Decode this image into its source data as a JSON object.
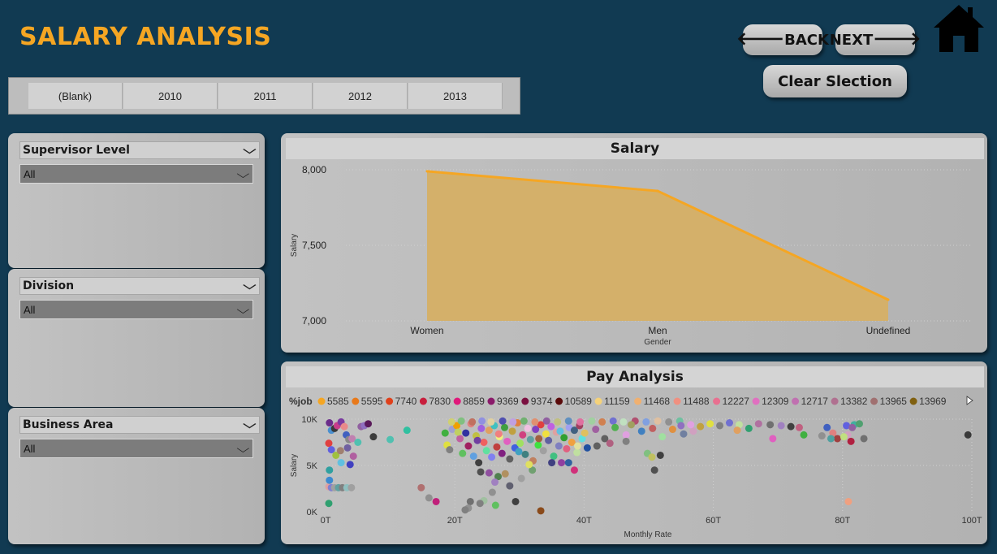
{
  "page": {
    "title": "SALARY ANALYSIS"
  },
  "nav": {
    "back_label": "BACK",
    "next_label": "NEXT",
    "clear_label": "Clear Slection",
    "back_arrow": "🡐",
    "next_arrow": "🡒"
  },
  "year_slicer": {
    "items": [
      "(Blank)",
      "2010",
      "2011",
      "2012",
      "2013"
    ]
  },
  "slicers": [
    {
      "title": "Supervisor Level",
      "value": "All"
    },
    {
      "title": "Division",
      "value": "All"
    },
    {
      "title": "Business Area",
      "value": "All"
    }
  ],
  "salary_chart": {
    "title": "Salary"
  },
  "pay_chart": {
    "title": "Pay Analysis",
    "legend_title": "%job"
  },
  "colors": {
    "background": "#113a52",
    "accent": "#f5a623",
    "area_fill": "#d4b06a",
    "area_line": "#f5a623"
  },
  "chart_data": [
    {
      "type": "area",
      "title": "Salary",
      "xlabel": "Gender",
      "ylabel": "Salary",
      "categories": [
        "Women",
        "Men",
        "Undefined"
      ],
      "values": [
        7990,
        7860,
        7140
      ],
      "ylim": [
        7000,
        8000
      ],
      "yticks": [
        {
          "v": 7000,
          "label": "7,000"
        },
        {
          "v": 7500,
          "label": "7,500"
        },
        {
          "v": 8000,
          "label": "8,000"
        }
      ],
      "grid": true
    },
    {
      "type": "scatter",
      "title": "Pay Analysis",
      "xlabel": "Monthly Rate",
      "ylabel": "Salary",
      "xlim": [
        0,
        100000
      ],
      "ylim": [
        0,
        10000
      ],
      "xticks": [
        {
          "v": 0,
          "label": "0T"
        },
        {
          "v": 20000,
          "label": "20T"
        },
        {
          "v": 40000,
          "label": "40T"
        },
        {
          "v": 60000,
          "label": "60T"
        },
        {
          "v": 80000,
          "label": "80T"
        },
        {
          "v": 100000,
          "label": "100T"
        }
      ],
      "yticks": [
        {
          "v": 0,
          "label": "0K"
        },
        {
          "v": 5000,
          "label": "5K"
        },
        {
          "v": 10000,
          "label": "10K"
        }
      ],
      "grid": true,
      "legend": [
        {
          "name": "5585",
          "color": "#f5a623"
        },
        {
          "name": "5595",
          "color": "#e8791a"
        },
        {
          "name": "7740",
          "color": "#e0401a"
        },
        {
          "name": "7830",
          "color": "#c81e3c"
        },
        {
          "name": "8859",
          "color": "#e0187a"
        },
        {
          "name": "9369",
          "color": "#8a1a6a"
        },
        {
          "name": "9374",
          "color": "#7a1040"
        },
        {
          "name": "10589",
          "color": "#5a0a0a"
        },
        {
          "name": "11159",
          "color": "#f5d27a"
        },
        {
          "name": "11468",
          "color": "#f0b070"
        },
        {
          "name": "11488",
          "color": "#f09080"
        },
        {
          "name": "12227",
          "color": "#e87090"
        },
        {
          "name": "12309",
          "color": "#e070c0"
        },
        {
          "name": "12717",
          "color": "#c070b0"
        },
        {
          "name": "13382",
          "color": "#b07090"
        },
        {
          "name": "13965",
          "color": "#a07070"
        },
        {
          "name": "13969",
          "color": "#806010"
        }
      ],
      "points": [
        [
          600,
          9600,
          "#6a2c8a"
        ],
        [
          900,
          8800,
          "#4a90d0"
        ],
        [
          1400,
          9000,
          "#3a3a3a"
        ],
        [
          1800,
          9300,
          "#c83c8a"
        ],
        [
          2400,
          9700,
          "#7a3aa0"
        ],
        [
          2900,
          9200,
          "#e88a8a"
        ],
        [
          3200,
          8300,
          "#4060c0"
        ],
        [
          3600,
          7800,
          "#888"
        ],
        [
          4100,
          7900,
          "#c080b0"
        ],
        [
          500,
          7400,
          "#e04040"
        ],
        [
          900,
          6700,
          "#6060e0"
        ],
        [
          1600,
          6100,
          "#a0c040"
        ],
        [
          2400,
          5300,
          "#60c0e0"
        ],
        [
          600,
          4500,
          "#30a0a0"
        ],
        [
          500,
          2700,
          "#e0a0a0"
        ],
        [
          900,
          2600,
          "#8080d0"
        ],
        [
          1400,
          2600,
          "#a0a0a0"
        ],
        [
          2000,
          2600,
          "#60a0a0"
        ],
        [
          2600,
          2600,
          "#808080"
        ],
        [
          3300,
          2600,
          "#90c0c0"
        ],
        [
          4000,
          2600,
          "#a0a0a0"
        ],
        [
          500,
          900,
          "#30a070"
        ],
        [
          600,
          3400,
          "#3c8ad0"
        ],
        [
          2300,
          6600,
          "#a08070"
        ],
        [
          3400,
          6900,
          "#7060a0"
        ],
        [
          3800,
          5100,
          "#4040c0"
        ],
        [
          4300,
          6000,
          "#b060a0"
        ],
        [
          5000,
          7500,
          "#50c0b0"
        ],
        [
          5500,
          9200,
          "#9060a0"
        ],
        [
          6000,
          9300,
          "#9070c0"
        ],
        [
          6600,
          9500,
          "#5a1a5a"
        ],
        [
          7400,
          8100,
          "#3c3c3c"
        ],
        [
          10000,
          7800,
          "#50c0b0"
        ],
        [
          12600,
          8800,
          "#30c0a0"
        ],
        [
          14800,
          2600,
          "#b07070"
        ],
        [
          17100,
          1100,
          "#c0207a"
        ],
        [
          16000,
          1500,
          "#909090"
        ],
        [
          18500,
          8500,
          "#40b040"
        ],
        [
          18800,
          7200,
          "#e0e040"
        ],
        [
          19200,
          6700,
          "#808080"
        ],
        [
          19600,
          8900,
          "#a0a0d0"
        ],
        [
          20300,
          9300,
          "#f0a000"
        ],
        [
          20800,
          7900,
          "#c060a0"
        ],
        [
          21200,
          6300,
          "#60c060"
        ],
        [
          21700,
          8500,
          "#3030a0"
        ],
        [
          22100,
          7100,
          "#a02060"
        ],
        [
          22500,
          9500,
          "#e08080"
        ],
        [
          22900,
          6000,
          "#60a0e0"
        ],
        [
          23300,
          8200,
          "#c0c040"
        ],
        [
          23700,
          5300,
          "#404040"
        ],
        [
          24100,
          9000,
          "#a060e0"
        ],
        [
          24500,
          7500,
          "#f06060"
        ],
        [
          24900,
          6600,
          "#60e0a0"
        ],
        [
          25300,
          8800,
          "#e0a060"
        ],
        [
          25700,
          5900,
          "#8080f0"
        ],
        [
          26100,
          9300,
          "#40c0c0"
        ],
        [
          26500,
          7000,
          "#c04040"
        ],
        [
          26900,
          8100,
          "#f0f080"
        ],
        [
          27300,
          6300,
          "#802080"
        ],
        [
          27700,
          9100,
          "#40a040"
        ],
        [
          28100,
          7600,
          "#e060c0"
        ],
        [
          28500,
          5700,
          "#606060"
        ],
        [
          28900,
          8700,
          "#c0a040"
        ],
        [
          29300,
          6900,
          "#4060e0"
        ],
        [
          29700,
          9600,
          "#e08040"
        ],
        [
          30100,
          7400,
          "#a0e060"
        ],
        [
          30500,
          8300,
          "#d04080"
        ],
        [
          30900,
          6200,
          "#408080"
        ],
        [
          31300,
          9000,
          "#f0c0e0"
        ],
        [
          31700,
          7800,
          "#60a0a0"
        ],
        [
          32100,
          5500,
          "#c08060"
        ],
        [
          32500,
          8900,
          "#8040c0"
        ],
        [
          32900,
          7200,
          "#40e040"
        ],
        [
          33300,
          9400,
          "#e04040"
        ],
        [
          33700,
          6600,
          "#a0a0a0"
        ],
        [
          34100,
          8400,
          "#f0e040"
        ],
        [
          34500,
          7700,
          "#6060a0"
        ],
        [
          34900,
          9200,
          "#c060e0"
        ],
        [
          35300,
          6000,
          "#40c080"
        ],
        [
          35700,
          8600,
          "#e0a0a0"
        ],
        [
          36100,
          7100,
          "#8080c0"
        ],
        [
          36500,
          9500,
          "#c0c0c0"
        ],
        [
          36900,
          8000,
          "#30a030"
        ],
        [
          37300,
          6800,
          "#e06080"
        ],
        [
          37700,
          9100,
          "#a0a0f0"
        ],
        [
          38100,
          7500,
          "#f0a040"
        ],
        [
          38500,
          8800,
          "#406080"
        ],
        [
          38900,
          6400,
          "#c0e0a0"
        ],
        [
          39300,
          9300,
          "#a04060"
        ],
        [
          39700,
          7900,
          "#60e0e0"
        ],
        [
          40100,
          8500,
          "#e0c060"
        ],
        [
          40500,
          6900,
          "#2050a0"
        ],
        [
          19500,
          9700,
          "#d0d070"
        ],
        [
          21000,
          9800,
          "#80c080"
        ],
        [
          22700,
          9700,
          "#c07060"
        ],
        [
          24200,
          9800,
          "#9090e0"
        ],
        [
          25600,
          9700,
          "#e0d0a0"
        ],
        [
          27400,
          9800,
          "#5050b0"
        ],
        [
          29000,
          9700,
          "#c0a0e0"
        ],
        [
          30700,
          9800,
          "#70b070"
        ],
        [
          32400,
          9700,
          "#e09070"
        ],
        [
          34200,
          9800,
          "#9060a0"
        ],
        [
          35900,
          9700,
          "#c0c080"
        ],
        [
          37600,
          9800,
          "#6090c0"
        ],
        [
          39400,
          9700,
          "#e070a0"
        ],
        [
          41200,
          9800,
          "#a0d0a0"
        ],
        [
          42800,
          9700,
          "#d08050"
        ],
        [
          44500,
          9800,
          "#7070d0"
        ],
        [
          46100,
          9700,
          "#c0e0c0"
        ],
        [
          47900,
          9800,
          "#b05070"
        ],
        [
          49600,
          9700,
          "#80a0e0"
        ],
        [
          51400,
          9800,
          "#e0c0a0"
        ],
        [
          53100,
          9700,
          "#909090"
        ],
        [
          54800,
          9800,
          "#70c0a0"
        ],
        [
          20500,
          8600,
          "#c0d060"
        ],
        [
          23500,
          7700,
          "#7040a0"
        ],
        [
          26800,
          8400,
          "#f08080"
        ],
        [
          29900,
          6500,
          "#40a0c0"
        ],
        [
          33000,
          7900,
          "#a06040"
        ],
        [
          36300,
          8700,
          "#60c0e0"
        ],
        [
          39000,
          7100,
          "#e0e0a0"
        ],
        [
          41800,
          8900,
          "#a060a0"
        ],
        [
          43200,
          7900,
          "#606060"
        ],
        [
          44800,
          9100,
          "#50b050"
        ],
        [
          46500,
          8300,
          "#e0a0e0"
        ],
        [
          47300,
          9400,
          "#a0a060"
        ],
        [
          48900,
          8700,
          "#4080c0"
        ],
        [
          50600,
          9000,
          "#c06060"
        ],
        [
          52100,
          8100,
          "#a0e0a0"
        ],
        [
          53700,
          8900,
          "#e09040"
        ],
        [
          55400,
          8400,
          "#7080a0"
        ],
        [
          56900,
          8700,
          "#d0a0c0"
        ],
        [
          24000,
          4300,
          "#505050"
        ],
        [
          25300,
          4200,
          "#9050a0"
        ],
        [
          26700,
          3800,
          "#508050"
        ],
        [
          27800,
          4100,
          "#b09060"
        ],
        [
          26200,
          3200,
          "#a080c0"
        ],
        [
          28500,
          2800,
          "#606070"
        ],
        [
          25800,
          2100,
          "#909090"
        ],
        [
          24500,
          1200,
          "#a0c0a0"
        ],
        [
          23900,
          900,
          "#808080"
        ],
        [
          22400,
          1100,
          "#707070"
        ],
        [
          22100,
          400,
          "#909090"
        ],
        [
          21600,
          200,
          "#808080"
        ],
        [
          26300,
          700,
          "#60c060"
        ],
        [
          29400,
          1100,
          "#404040"
        ],
        [
          33300,
          100,
          "#8a4a1a"
        ],
        [
          30300,
          3600,
          "#a0a0a0"
        ],
        [
          35000,
          5300,
          "#404080"
        ],
        [
          36500,
          5300,
          "#9040a0"
        ],
        [
          37600,
          5300,
          "#3060a0"
        ],
        [
          38500,
          4500,
          "#d0307a"
        ],
        [
          32000,
          4500,
          "#70a070"
        ],
        [
          31500,
          5100,
          "#e0e060"
        ],
        [
          42000,
          7100,
          "#606060"
        ],
        [
          44000,
          7400,
          "#b06080"
        ],
        [
          46500,
          7600,
          "#808080"
        ],
        [
          49800,
          6300,
          "#80c080"
        ],
        [
          50500,
          5900,
          "#c0c060"
        ],
        [
          51800,
          6100,
          "#404040"
        ],
        [
          50900,
          4500,
          "#505050"
        ],
        [
          55000,
          9300,
          "#9070c0"
        ],
        [
          56500,
          9400,
          "#e0a0e0"
        ],
        [
          58000,
          9200,
          "#c0a040"
        ],
        [
          59500,
          9500,
          "#e0e040"
        ],
        [
          61000,
          9300,
          "#808080"
        ],
        [
          62500,
          9600,
          "#7070d0"
        ],
        [
          64000,
          9400,
          "#c0e0a0"
        ],
        [
          63700,
          8800,
          "#e0a060"
        ],
        [
          65500,
          9000,
          "#30a070"
        ],
        [
          67000,
          9500,
          "#b070a0"
        ],
        [
          68800,
          9400,
          "#707070"
        ],
        [
          70500,
          9300,
          "#a080c0"
        ],
        [
          69200,
          7900,
          "#e060c0"
        ],
        [
          72000,
          9200,
          "#404040"
        ],
        [
          73300,
          9100,
          "#c06080"
        ],
        [
          74000,
          8300,
          "#40b040"
        ],
        [
          76800,
          8200,
          "#909090"
        ],
        [
          77600,
          9100,
          "#4060c0"
        ],
        [
          78500,
          8500,
          "#e08080"
        ],
        [
          79200,
          7900,
          "#a04040"
        ],
        [
          80800,
          8300,
          "#d0a0c0"
        ],
        [
          81300,
          7600,
          "#b02040"
        ],
        [
          78200,
          7900,
          "#50a0a0"
        ],
        [
          80200,
          8100,
          "#c0e080"
        ],
        [
          80600,
          9300,
          "#6060e0"
        ],
        [
          81800,
          9400,
          "#40b0a0"
        ],
        [
          82600,
          9500,
          "#50a070"
        ],
        [
          83300,
          7900,
          "#707070"
        ],
        [
          81500,
          9100,
          "#9060a0"
        ],
        [
          80900,
          1100,
          "#f0a080"
        ],
        [
          99400,
          8300,
          "#3a3a3a"
        ]
      ]
    }
  ]
}
